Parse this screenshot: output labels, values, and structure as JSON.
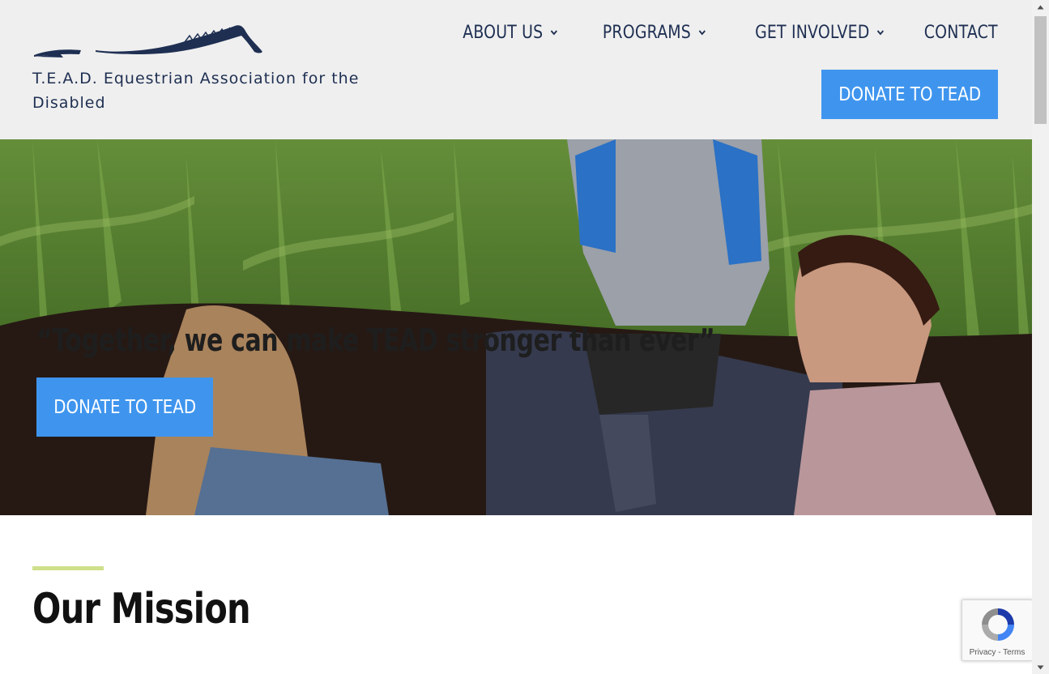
{
  "header": {
    "site_name": "T.E.A.D. Equestrian Association for the Disabled",
    "logo_icon": "horse-logo-icon",
    "nav": [
      {
        "label": "ABOUT US",
        "has_dropdown": true
      },
      {
        "label": "PROGRAMS",
        "has_dropdown": true
      },
      {
        "label": "GET INVOLVED",
        "has_dropdown": true
      },
      {
        "label": "CONTACT",
        "has_dropdown": false
      }
    ],
    "donate_label": "DONATE TO TEAD"
  },
  "hero": {
    "quote": "“Together, we can make TEAD stronger than ever”",
    "donate_label": "DONATE TO TEAD"
  },
  "mission": {
    "heading": "Our Mission"
  },
  "recaptcha": {
    "privacy": "Privacy",
    "separator": " - ",
    "terms": "Terms"
  },
  "colors": {
    "navy": "#1e2f52",
    "header_bg": "#efefef",
    "button_blue": "#3f95ee",
    "accent_lime": "#cfe08a"
  }
}
